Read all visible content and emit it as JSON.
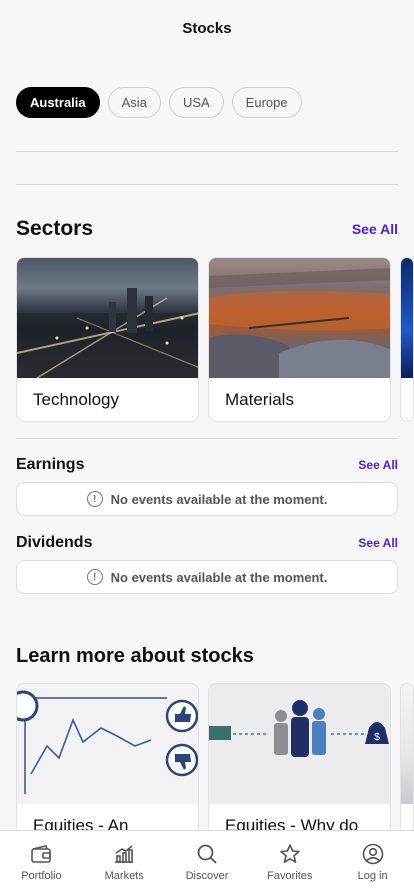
{
  "header": {
    "title": "Stocks"
  },
  "regions": [
    {
      "label": "Australia",
      "active": true
    },
    {
      "label": "Asia",
      "active": false
    },
    {
      "label": "USA",
      "active": false
    },
    {
      "label": "Europe",
      "active": false
    }
  ],
  "sectors": {
    "title": "Sectors",
    "see_all": "See All",
    "items": [
      {
        "label": "Technology"
      },
      {
        "label": "Materials"
      }
    ]
  },
  "earnings": {
    "title": "Earnings",
    "see_all": "See All",
    "empty_text": "No events available at the moment."
  },
  "dividends": {
    "title": "Dividends",
    "see_all": "See All",
    "empty_text": "No events available at the moment."
  },
  "learn": {
    "title": "Learn more about stocks",
    "items": [
      {
        "label": "Equities - An"
      },
      {
        "label": "Equities - Why do"
      }
    ]
  },
  "tabbar": {
    "items": [
      {
        "label": "Portfolio",
        "icon": "wallet-icon"
      },
      {
        "label": "Markets",
        "icon": "chart-icon"
      },
      {
        "label": "Discover",
        "icon": "search-icon"
      },
      {
        "label": "Favorites",
        "icon": "star-icon"
      },
      {
        "label": "Log in",
        "icon": "user-icon"
      }
    ]
  }
}
